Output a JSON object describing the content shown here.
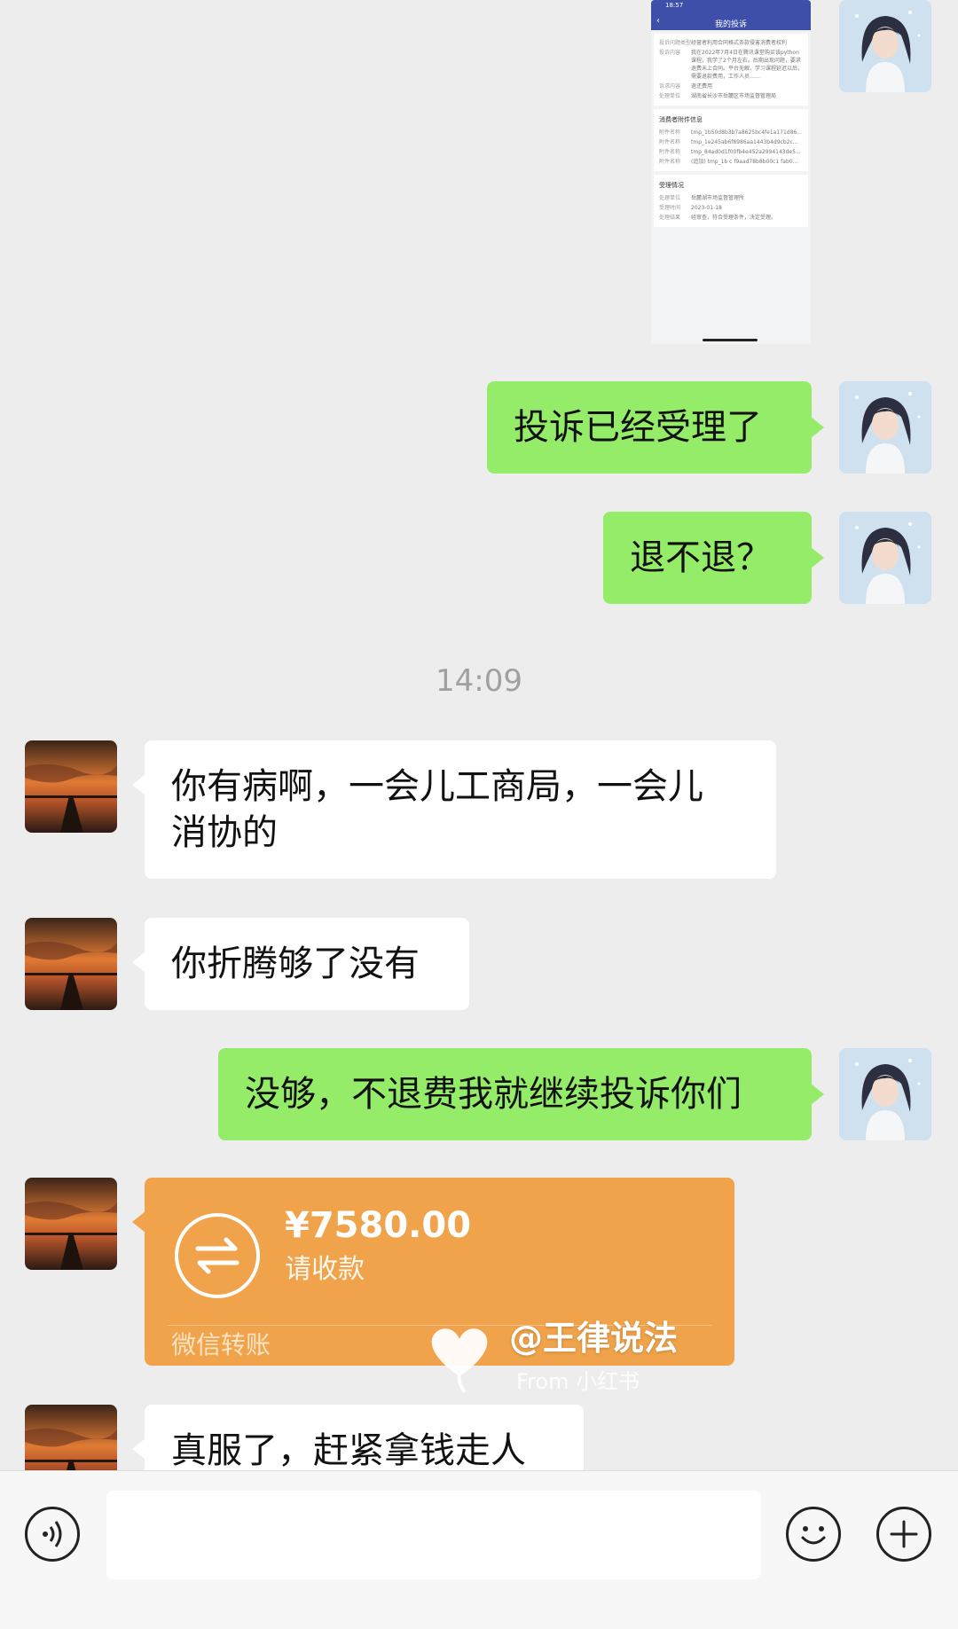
{
  "chat": {
    "timestamp": "14:09",
    "messages": [
      {
        "id": 1,
        "sender": "me",
        "type": "image",
        "content": "complaint-screenshot"
      },
      {
        "id": 2,
        "sender": "me",
        "type": "text",
        "text": "投诉已经受理了"
      },
      {
        "id": 3,
        "sender": "me",
        "type": "text",
        "text": "退不退？"
      },
      {
        "id": 4,
        "sender": "them",
        "type": "text",
        "line1": "你有病啊，一会儿工商局，一会儿",
        "line2": "消协的"
      },
      {
        "id": 5,
        "sender": "them",
        "type": "text",
        "text": "你折腾够了没有"
      },
      {
        "id": 6,
        "sender": "me",
        "type": "text",
        "text": "没够，不退费我就继续投诉你们"
      },
      {
        "id": 7,
        "sender": "them",
        "type": "transfer"
      },
      {
        "id": 8,
        "sender": "them",
        "type": "text",
        "text": "真服了，赶紧拿钱走人"
      }
    ]
  },
  "screenshot": {
    "status_time": "18:57",
    "title": "我的投诉",
    "section_attachments": "消费者附件信息",
    "section_handling": "受理情况",
    "row_k1": "投诉问题类型",
    "row_v1": "经营者利用合同格式条款侵害消费者权利",
    "row_k2": "投诉内容",
    "row_v2": "我在2022年7月4日在腾讯课堂购买该python课程，我学了2个月左右。后期出现问题，要求退费未上合同。平台无解，学习课程延迟以后，需要退款费用，工作人员……",
    "row_k3": "诉求内容",
    "row_v3": "退还费用",
    "row_k4": "处理单位",
    "row_v4": "湖南省长沙市岳麓区市场监督管理局",
    "att_k": "附件名称",
    "att1": "tmp_1b50d8b3b7a8625bc4fe1a171d86...",
    "att2": "tmp_1e245ab6f8986aa1443b4d9cb2c...",
    "att3": "tmp_84ad0d1f00fb4e452a2994143de5...",
    "att4": "(追加) tmp_1b c f9aad78b8b00c1 fab0...",
    "h_k1": "处理单位",
    "h_v1": "岳麓湖市场监督管理所",
    "h_k2": "受理时间",
    "h_v2": "2023-01-18",
    "h_k3": "处理结果",
    "h_v3": "经审查，符合受理条件，决定受理。"
  },
  "transfer": {
    "amount": "¥7580.00",
    "subtitle": "请收款",
    "label": "微信转账"
  },
  "watermark": {
    "name": "@王律说法",
    "from": "From 小红书"
  },
  "colors": {
    "my_bubble": "#95ec69",
    "their_bubble": "#ffffff",
    "transfer_card": "#f0a34a",
    "background": "#ededed"
  },
  "icons": {
    "voice": "voice-icon",
    "emoji": "emoji-icon",
    "plus": "plus-icon",
    "transfer": "transfer-icon"
  }
}
